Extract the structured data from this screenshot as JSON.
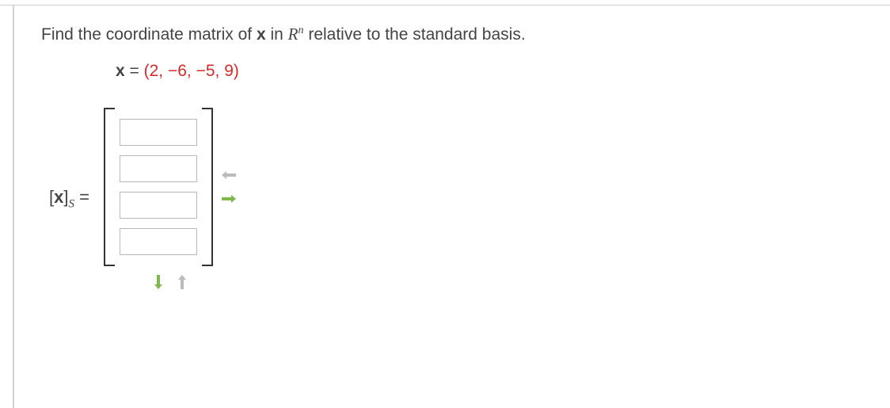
{
  "question": {
    "prefix": "Find the coordinate matrix of ",
    "bold_x": "x",
    "mid": " in ",
    "R": "R",
    "n": "n",
    "suffix": " relative to the standard basis."
  },
  "vector": {
    "x_label": "x",
    "equals": " = ",
    "value": "(2, −6, −5, 9)"
  },
  "matrix_label": {
    "open": "[",
    "x": "x",
    "close": "]",
    "sub": "S",
    "equals": " ="
  },
  "inputs": [
    "",
    "",
    "",
    ""
  ]
}
